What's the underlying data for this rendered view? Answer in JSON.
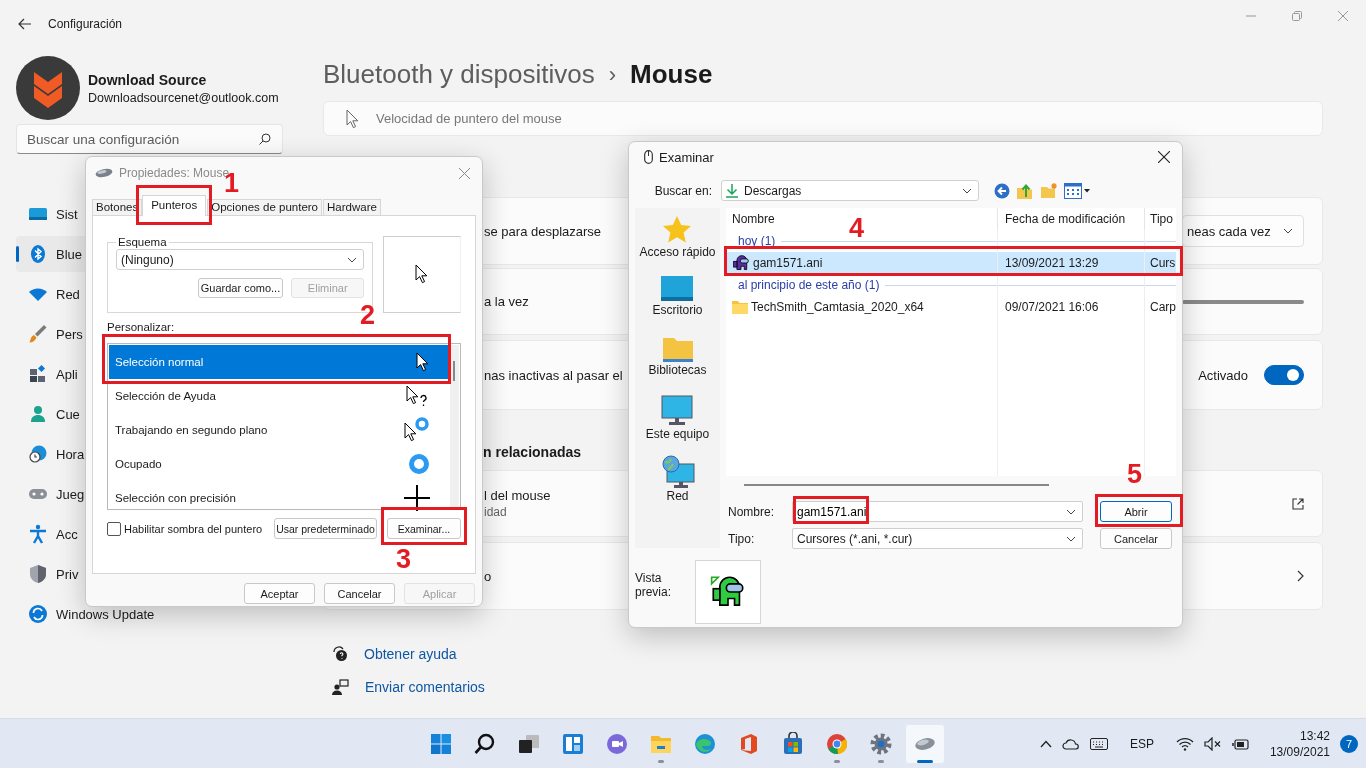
{
  "settings_window": {
    "title": "Configuración",
    "profile": {
      "name": "Download Source",
      "email": "Downloadsourcenet@outlook.com"
    },
    "search": {
      "placeholder": "Buscar una configuración"
    },
    "nav": [
      {
        "label": "Sist",
        "kind": "system",
        "selected": false
      },
      {
        "label": "Blue",
        "kind": "bluetooth",
        "selected": true
      },
      {
        "label": "Red",
        "kind": "network",
        "selected": false
      },
      {
        "label": "Pers",
        "kind": "personalization",
        "selected": false
      },
      {
        "label": "Apli",
        "kind": "apps",
        "selected": false
      },
      {
        "label": "Cue",
        "kind": "accounts",
        "selected": false
      },
      {
        "label": "Hora",
        "kind": "time",
        "selected": false
      },
      {
        "label": "Jueg",
        "kind": "gaming",
        "selected": false
      },
      {
        "label": "Acc",
        "kind": "accessibility",
        "selected": false
      },
      {
        "label": "Priv",
        "kind": "privacy",
        "selected": false
      },
      {
        "label": "Windows Update",
        "kind": "update",
        "selected": false
      }
    ],
    "breadcrumb": {
      "parent": "Bluetooth y dispositivos",
      "separator": "›",
      "current": "Mouse"
    },
    "cards": [
      {
        "kind": "pointer",
        "label": "Velocidad de puntero del mouse"
      },
      {
        "kind": "dropdown",
        "label": "se para desplazarse",
        "value": "neas cada vez"
      },
      {
        "kind": "slider",
        "label": "a la vez"
      },
      {
        "kind": "toggle",
        "label": "nas inactivas al pasar el",
        "state_label": "Activado",
        "on": true
      },
      {
        "kind": "heading",
        "label": "n relacionadas"
      },
      {
        "kind": "external",
        "label": "l del mouse",
        "sublabel": "idad"
      },
      {
        "kind": "chevron",
        "label": "o"
      }
    ],
    "links": [
      {
        "kind": "help",
        "label": "Obtener ayuda"
      },
      {
        "kind": "feedback",
        "label": "Enviar comentarios"
      }
    ]
  },
  "mouse_properties": {
    "title": "Propiedades: Mouse",
    "tabs": [
      {
        "label": "Botones",
        "selected": false
      },
      {
        "label": "Punteros",
        "selected": true
      },
      {
        "label": "Opciones de puntero",
        "selected": false
      },
      {
        "label": "Hardware",
        "selected": false
      }
    ],
    "scheme": {
      "legend": "Esquema",
      "value": "(Ninguno)",
      "buttons": [
        {
          "label": "Guardar como...",
          "disabled": false
        },
        {
          "label": "Eliminar",
          "disabled": true
        }
      ]
    },
    "customize_label": "Personalizar:",
    "cursors": [
      {
        "name": "Selección normal",
        "kind": "arrow",
        "selected": true
      },
      {
        "name": "Selección de Ayuda",
        "kind": "help",
        "selected": false
      },
      {
        "name": "Trabajando en segundo plano",
        "kind": "working",
        "selected": false
      },
      {
        "name": "Ocupado",
        "kind": "busy",
        "selected": false
      },
      {
        "name": "Selección con precisión",
        "kind": "precision",
        "selected": false
      }
    ],
    "shadow": {
      "label": "Habilitar sombra del puntero",
      "checked": false
    },
    "actions": [
      {
        "label": "Usar predeterminado"
      },
      {
        "label": "Examinar..."
      }
    ],
    "footer": [
      {
        "label": "Aceptar",
        "disabled": false
      },
      {
        "label": "Cancelar",
        "disabled": false
      },
      {
        "label": "Aplicar",
        "disabled": true
      }
    ]
  },
  "browse_dialog": {
    "title": "Examinar",
    "look_in": {
      "label": "Buscar en:",
      "value": "Descargas"
    },
    "places": [
      {
        "label": "Acceso rápido",
        "kind": "star"
      },
      {
        "label": "Escritorio",
        "kind": "desktop"
      },
      {
        "label": "Bibliotecas",
        "kind": "library"
      },
      {
        "label": "Este equipo",
        "kind": "computer"
      },
      {
        "label": "Red",
        "kind": "network"
      }
    ],
    "columns": [
      "Nombre",
      "Fecha de modificación",
      "Tipo"
    ],
    "groups": [
      {
        "label": "hoy (1)",
        "files": [
          {
            "name": "gam1571.ani",
            "date": "13/09/2021 13:29",
            "type": "Curs",
            "kind": "cursor",
            "selected": true
          }
        ]
      },
      {
        "label": "al principio de este año (1)",
        "files": [
          {
            "name": "TechSmith_Camtasia_2020_x64",
            "date": "09/07/2021 16:06",
            "type": "Carp",
            "kind": "folder",
            "selected": false
          }
        ]
      }
    ],
    "filename": {
      "label": "Nombre:",
      "value": "gam1571.ani"
    },
    "filetype": {
      "label": "Tipo:",
      "value": "Cursores (*.ani, *.cur)"
    },
    "buttons": [
      {
        "label": "Abrir",
        "default": true
      },
      {
        "label": "Cancelar",
        "default": false
      }
    ],
    "preview_label": "Vista previa:"
  },
  "annotations": [
    {
      "kind": "numbered",
      "number": "1"
    },
    {
      "kind": "numbered",
      "number": "2"
    },
    {
      "kind": "numbered",
      "number": "3"
    },
    {
      "kind": "numbered",
      "number": "4"
    },
    {
      "kind": "numbered",
      "number": "5"
    },
    {
      "kind": "plain"
    }
  ],
  "taskbar": {
    "apps": [
      {
        "kind": "start",
        "running": false,
        "selected": false
      },
      {
        "kind": "search",
        "running": false,
        "selected": false
      },
      {
        "kind": "taskview",
        "running": false,
        "selected": false
      },
      {
        "kind": "widgets",
        "running": false,
        "selected": false
      },
      {
        "kind": "chat",
        "running": false,
        "selected": false
      },
      {
        "kind": "explorer",
        "running": true,
        "selected": false
      },
      {
        "kind": "edge",
        "running": false,
        "selected": false
      },
      {
        "kind": "office",
        "running": false,
        "selected": false
      },
      {
        "kind": "store",
        "running": false,
        "selected": false
      },
      {
        "kind": "chrome",
        "running": true,
        "selected": false
      },
      {
        "kind": "settings",
        "running": true,
        "selected": false
      },
      {
        "kind": "mouse",
        "running": true,
        "selected": true
      }
    ],
    "tray": {
      "language": "ESP",
      "time": "13:42",
      "date": "13/09/2021",
      "notifications": "7"
    }
  }
}
